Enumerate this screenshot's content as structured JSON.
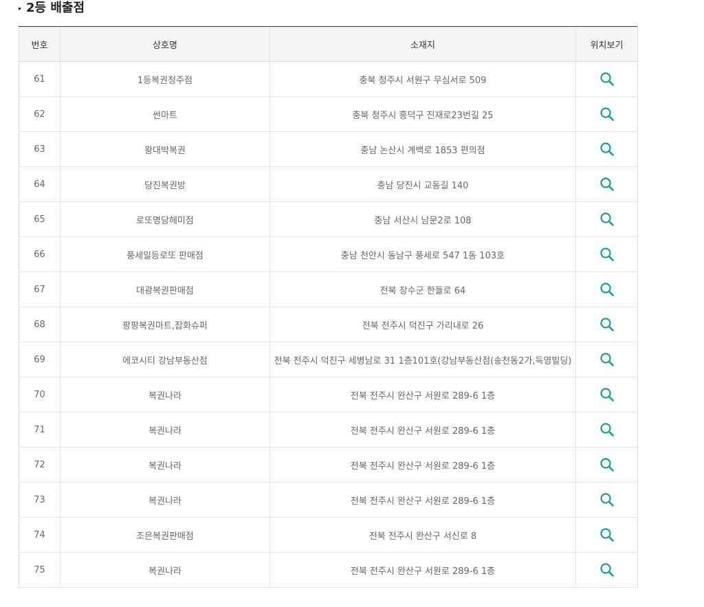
{
  "section": {
    "title": "2등 배출점"
  },
  "table": {
    "headers": {
      "no": "번호",
      "name": "상호명",
      "address": "소재지",
      "location": "위치보기"
    },
    "rows": [
      {
        "no": "61",
        "name": "1등복권청주점",
        "address": "충북 청주시 서원구 무심서로 509"
      },
      {
        "no": "62",
        "name": "썬마트",
        "address": "충북 청주시 흥덕구 진재로23번길 25"
      },
      {
        "no": "63",
        "name": "왕대박복권",
        "address": "충남 논산시 계백로 1853 편의점"
      },
      {
        "no": "64",
        "name": "당진복권방",
        "address": "충남 당진시 교동길 140"
      },
      {
        "no": "65",
        "name": "로또명당헤미점",
        "address": "충남 서산시 남문2로 108"
      },
      {
        "no": "66",
        "name": "풍세일등로또 판매점",
        "address": "충남 천안시 동남구 풍세로 547 1동 103호"
      },
      {
        "no": "67",
        "name": "대광복권판매점",
        "address": "전북 장수군 한들로 64"
      },
      {
        "no": "68",
        "name": "팡팡복권마트,잡화슈퍼",
        "address": "전북 전주시 덕진구 가리내로 26"
      },
      {
        "no": "69",
        "name": "에코시티 강남부동산점",
        "address": "전북 전주시 덕진구 세병남로 31 1층101호(강남부동산점(송천동2가,득영빌딩)"
      },
      {
        "no": "70",
        "name": "복권나라",
        "address": "전북 전주시 완산구 서원로 289-6 1층"
      },
      {
        "no": "71",
        "name": "복권나라",
        "address": "전북 전주시 완산구 서원로 289-6 1층"
      },
      {
        "no": "72",
        "name": "복권나라",
        "address": "전북 전주시 완산구 서원로 289-6 1층"
      },
      {
        "no": "73",
        "name": "복권나라",
        "address": "전북 전주시 완산구 서원로 289-6 1층"
      },
      {
        "no": "74",
        "name": "조은복권판매점",
        "address": "전북 전주시 완산구 서신로 8"
      },
      {
        "no": "75",
        "name": "복권나라",
        "address": "전북 전주시 완산구 서원로 289-6 1층"
      }
    ]
  },
  "icons": {
    "location": "search-icon"
  },
  "colors": {
    "icon": "#1a9e8f",
    "header_bg": "#f5f5f5",
    "top_border": "#333333"
  }
}
